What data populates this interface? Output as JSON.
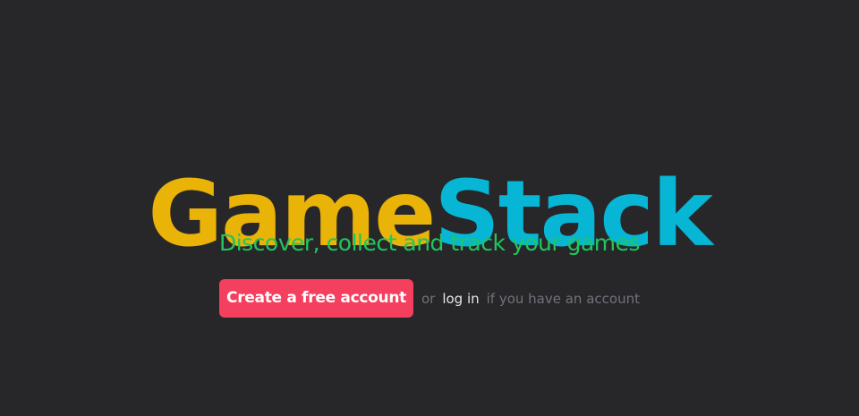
{
  "logo": {
    "part1": "Game",
    "part2": "Stack",
    "colors": {
      "part1": "#eab308",
      "part2": "#06b6d4"
    }
  },
  "tagline": "Discover, collect and track your games",
  "cta": {
    "button_label": "Create a free account",
    "or_text": "or",
    "login_label": "log in",
    "suffix_text": "if you have an account"
  },
  "colors": {
    "background": "#27272a",
    "tagline": "#22c55e",
    "button": "#f43f5e"
  }
}
